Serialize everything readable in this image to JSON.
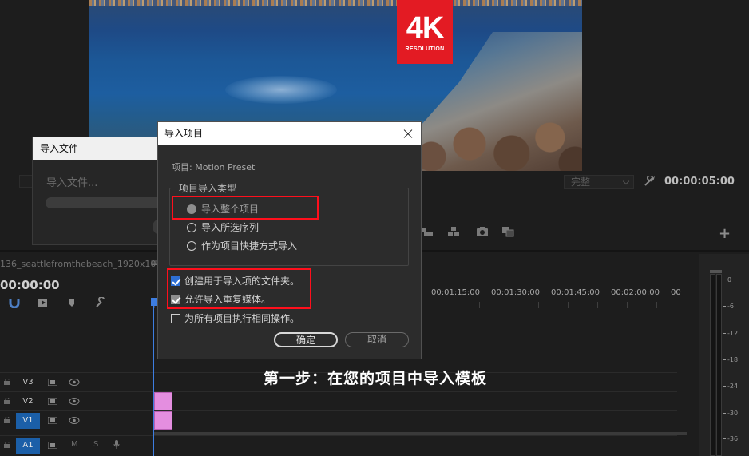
{
  "preview": {
    "badge_main": "4K",
    "badge_sub": "RESOLUTION",
    "badge_color": "#e31b23"
  },
  "program_monitor": {
    "quality": "完整",
    "duration": "00:00:05:00",
    "icons": [
      "insert-icon",
      "overwrite-icon",
      "export-frame-icon",
      "comparison-icon",
      "add-button-icon"
    ]
  },
  "import_file_dialog": {
    "title": "导入文件",
    "label": "导入文件..."
  },
  "import_project_dialog": {
    "title": "导入项目",
    "project_line": "项目: Motion Preset",
    "group_title": "项目导入类型",
    "options": [
      {
        "label": "导入整个项目",
        "selected": true
      },
      {
        "label": "导入所选序列",
        "selected": false
      },
      {
        "label": "作为项目快捷方式导入",
        "selected": false
      }
    ],
    "checkboxes": [
      {
        "label": "创建用于导入项的文件夹。",
        "checked": true
      },
      {
        "label": "允许导入重复媒体。",
        "checked": true
      },
      {
        "label": "为所有项目执行相同操作。",
        "checked": false
      }
    ],
    "ok_label": "确定",
    "cancel_label": "取消",
    "highlight_color": "#ff0f1c"
  },
  "timeline": {
    "sequence_name": "136_seattlefromthebeach_1920x1080",
    "menu_glyph": "≡",
    "timecode": "00:00:00",
    "ruler": [
      "00:01:15:00",
      "00:01:30:00",
      "00:01:45:00",
      "00:02:00:00",
      "00"
    ],
    "tracks": [
      {
        "name": "V3",
        "active": false
      },
      {
        "name": "V2",
        "active": false
      },
      {
        "name": "V1",
        "active": true
      },
      {
        "name": "A1",
        "active": true
      }
    ],
    "audio_labels": {
      "mute": "M",
      "solo": "S"
    },
    "clip_color": "#e48ee0"
  },
  "meter": {
    "scale": [
      "0",
      "-6",
      "-12",
      "-18",
      "-24",
      "-30",
      "-36"
    ]
  },
  "caption": "第一步：在您的项目中导入模板"
}
